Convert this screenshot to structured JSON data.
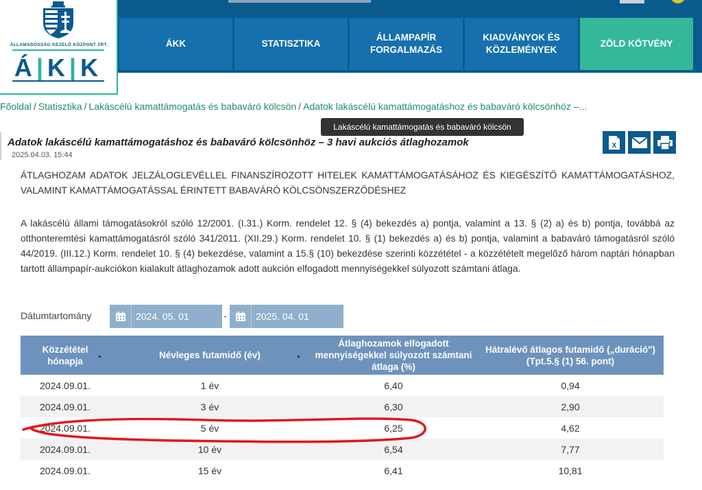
{
  "logo": {
    "org_text": "ÁLLAMADÓSSÁG KEZELŐ KÖZPONT ZRT.",
    "abbr": [
      "Á",
      "K",
      "K"
    ]
  },
  "nav": [
    {
      "label": "ÁKK"
    },
    {
      "label": "STATISZTIKA"
    },
    {
      "label": "ÁLLAMPAPÍR FORGALMAZÁS"
    },
    {
      "label": "KIADVÁNYOK ÉS KÖZLEMÉNYEK"
    },
    {
      "label": "ZÖLD KÖTVÉNY"
    }
  ],
  "breadcrumb": {
    "items": [
      "Főoldal",
      "Statisztika",
      "Lakáscélú kamattámogatás és babaváró kölcsön",
      "Adatok lakáscélú kamattámogatáshoz és babaváró kölcsönhöz –..."
    ],
    "separator": "/"
  },
  "tooltip": "Lakáscélú kamattámogatás és babaváró kölcsön",
  "article": {
    "title": "Adatok lakáscélú kamattámogatáshoz és babaváró kölcsönhöz – 3 havi aukciós átlaghozamok",
    "date": "2025.04.03. 15:44",
    "heading": "ÁTLAGHOZAM ADATOK JELZÁLOGLEVÉLLEL FINANSZÍROZOTT HITELEK KAMATTÁMOGATÁSÁHOZ ÉS KIEGÉSZÍTŐ KAMATTÁMOGATÁSHOZ, VALAMINT KAMATTÁMOGATÁSSAL ÉRINTETT BABAVÁRÓ KÖLCSÖNSZERZŐDÉSHEZ",
    "body": "A lakáscélú állami támogatásokról szóló 12/2001. (I.31.) Korm. rendelet 12. § (4) bekezdés a) pontja, valamint a 13. § (2) a) és b) pontja, továbbá az otthonteremtési kamattámogatásról szóló 341/2011. (XII.29.) Korm. rendelet 10. § (1) bekezdés a) és b) pontja, valamint a babaváró támogatásról szóló 44/2019. (III.12.) Korm. rendelet 10. § (4) bekezdése, valamint a 15.§ (10) bekezdése szerinti közzététel - a közzétételt megelőző három naptári hónapban tartott állampapír-aukciókon kialakult átlaghozamok adott aukción elfogadott mennyiségekkel súlyozott számtani átlaga."
  },
  "actions": {
    "excel_icon": "excel-icon",
    "email_icon": "envelope-icon",
    "print_icon": "printer-icon"
  },
  "date_range": {
    "label": "Dátumtartomány",
    "from": "2024. 05. 01",
    "to": "2025. 04. 01",
    "separator": "-"
  },
  "table": {
    "headers": [
      "Közzététel hónapja",
      "Névleges futamidő (év)",
      "Átlaghozamok elfogadott mennyiségekkel súlyozott számtani átlaga (%)",
      "Hátralévő átlagos futamidő („duráció\") (Tpt.5.§ (1) 56. pont)"
    ],
    "rows": [
      [
        "2024.09.01.",
        "1 év",
        "6,40",
        "0,94"
      ],
      [
        "2024.09.01.",
        "3 év",
        "6,30",
        "2,90"
      ],
      [
        "2024.09.01.",
        "5 év",
        "6,25",
        "4,62"
      ],
      [
        "2024.09.01.",
        "10 év",
        "6,54",
        "7,77"
      ],
      [
        "2024.09.01.",
        "15 év",
        "6,41",
        "10,81"
      ]
    ]
  },
  "colors": {
    "brand_blue": "#0b5a8e",
    "nav_blue": "#1670ad",
    "nav_green": "#33b89a",
    "link_green": "#1c8b75",
    "table_header": "#6d93bd",
    "annotation_red": "#e0181b"
  }
}
